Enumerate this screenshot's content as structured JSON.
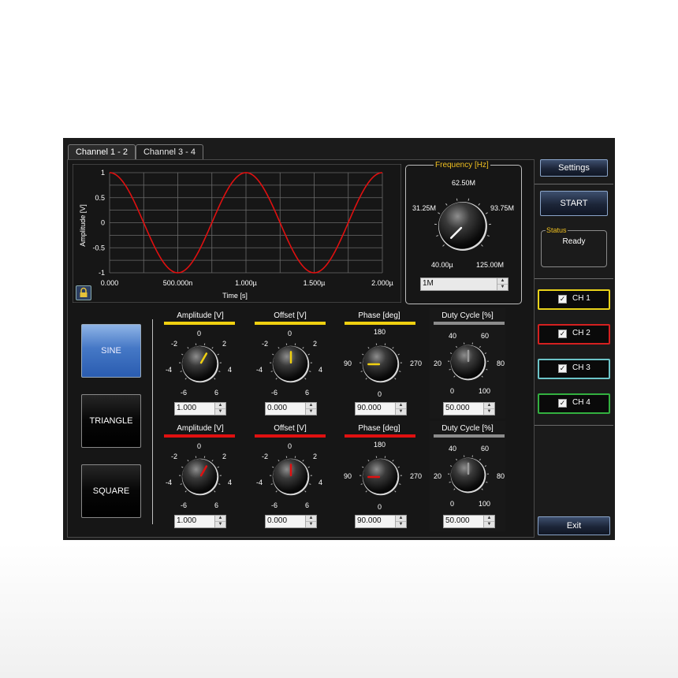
{
  "tabs": [
    "Channel 1 - 2",
    "Channel 3 - 4"
  ],
  "chart_data": {
    "type": "line",
    "xlabel": "Time [s]",
    "ylabel": "Amplitude [V]",
    "x_tick_labels": [
      "0.000",
      "500.000n",
      "1.000µ",
      "1.500µ",
      "2.000µ"
    ],
    "y_tick_labels": [
      "1",
      "0.5",
      "0",
      "-0.5",
      "-1"
    ],
    "xlim_s": [
      0,
      2e-06
    ],
    "ylim": [
      -1,
      1
    ],
    "grid": true,
    "series": [
      {
        "color": "#e01010",
        "function": "cosine",
        "amplitude": 1,
        "period_s": 1e-06
      }
    ]
  },
  "frequency": {
    "title": "Frequency [Hz]",
    "labels": {
      "top": "62.50M",
      "left": "31.25M",
      "right": "93.75M",
      "bottom_left": "40.00µ",
      "bottom_right": "125.00M"
    },
    "value": "1M"
  },
  "right_panel": {
    "settings": "Settings",
    "start": "START",
    "status_title": "Status",
    "status_value": "Ready",
    "exit": "Exit",
    "channels": [
      {
        "label": "CH 1",
        "color": "#e8d21a",
        "checked": "✓"
      },
      {
        "label": "CH 2",
        "color": "#d42020",
        "checked": "✓"
      },
      {
        "label": "CH 3",
        "color": "#6cc4c8",
        "checked": "✓"
      },
      {
        "label": "CH 4",
        "color": "#33b040",
        "checked": "✓"
      }
    ]
  },
  "waveforms": {
    "sine": "SINE",
    "triangle": "TRIANGLE",
    "square": "SQUARE",
    "selected": "SINE"
  },
  "channel1": {
    "color": "#f0d010",
    "amplitude": {
      "title": "Amplitude [V]",
      "labels": [
        "-2",
        "0",
        "2",
        "-4",
        "4",
        "-6",
        "6"
      ],
      "value": "1.000"
    },
    "offset": {
      "title": "Offset [V]",
      "labels": [
        "-2",
        "0",
        "2",
        "-4",
        "4",
        "-6",
        "6"
      ],
      "value": "0.000"
    },
    "phase": {
      "title": "Phase [deg]",
      "labels": [
        "180",
        "90",
        "270",
        "0"
      ],
      "value": "90.000"
    },
    "duty": {
      "title": "Duty Cycle [%]",
      "labels": [
        "40",
        "60",
        "20",
        "80",
        "0",
        "100"
      ],
      "value": "50.000"
    }
  },
  "channel2": {
    "color": "#e01010",
    "amplitude": {
      "title": "Amplitude [V]",
      "labels": [
        "-2",
        "0",
        "2",
        "-4",
        "4",
        "-6",
        "6"
      ],
      "value": "1.000"
    },
    "offset": {
      "title": "Offset [V]",
      "labels": [
        "-2",
        "0",
        "2",
        "-4",
        "4",
        "-6",
        "6"
      ],
      "value": "0.000"
    },
    "phase": {
      "title": "Phase [deg]",
      "labels": [
        "180",
        "90",
        "270",
        "0"
      ],
      "value": "90.000"
    },
    "duty": {
      "title": "Duty Cycle [%]",
      "labels": [
        "40",
        "60",
        "20",
        "80",
        "0",
        "100"
      ],
      "value": "50.000"
    }
  }
}
